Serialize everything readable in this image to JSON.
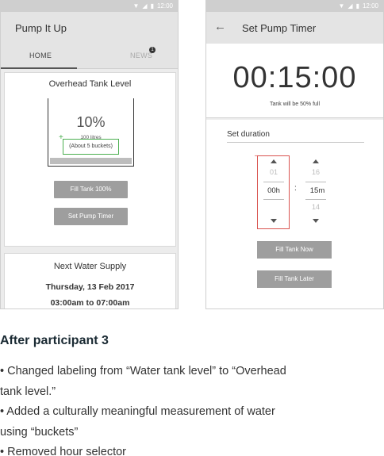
{
  "status_time": "12:00",
  "left_phone": {
    "app_title": "Pump It Up",
    "tabs": {
      "home": "HOME",
      "news": "NEWS",
      "news_badge": "1"
    },
    "tank_card": {
      "title": "Overhead Tank Level",
      "percent": "10%",
      "fill_level": 0.1,
      "litres": "100 litres",
      "buckets": "(About 5 buckets)",
      "plus": "+",
      "fill_button": "Fill Tank 100%",
      "timer_button": "Set Pump Timer"
    },
    "supply_card": {
      "title": "Next Water Supply",
      "date": "Thursday, 13 Feb 2017",
      "time": "03:00am to 07:00am"
    }
  },
  "right_phone": {
    "back_icon": "arrow-left-icon",
    "title": "Set Pump Timer",
    "timer_value": "00:15:00",
    "timer_note": "Tank will be 50% full",
    "duration_label": "Set duration",
    "hours": {
      "prev": "01",
      "current": "00h",
      "next": ""
    },
    "minutes": {
      "prev": "16",
      "current": "15m",
      "next": "14"
    },
    "separator": ":",
    "fill_now": "Fill Tank Now",
    "fill_later": "Fill Tank Later"
  },
  "caption": {
    "title": "After participant 3",
    "bullets": [
      "• Changed labeling from “Water tank level” to “Overhead tank level.”",
      "• Added a culturally meaningful measurement of water using “buckets”",
      "• Removed hour selector"
    ]
  }
}
